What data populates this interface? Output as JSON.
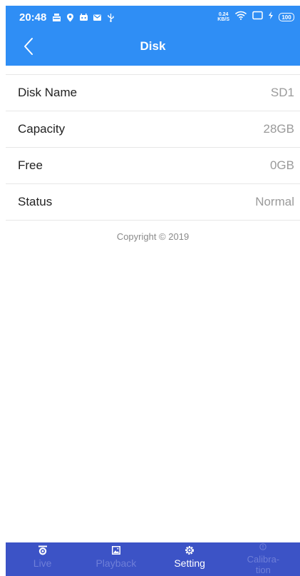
{
  "status_bar": {
    "time": "20:48",
    "net_speed_value": "0.24",
    "net_speed_unit": "KB/S",
    "battery": "100",
    "icons": [
      "notification-icon",
      "location-icon",
      "android-icon",
      "mail-icon",
      "usb-icon",
      "wifi-icon",
      "screen-icon",
      "charging-icon"
    ]
  },
  "header": {
    "title": "Disk",
    "back_icon": "chevron-left-icon"
  },
  "disk_info": [
    {
      "label": "Disk Name",
      "value": "SD1"
    },
    {
      "label": "Capacity",
      "value": "28GB"
    },
    {
      "label": "Free",
      "value": "0GB"
    },
    {
      "label": "Status",
      "value": "Normal"
    }
  ],
  "footer": {
    "copyright": "Copyright © 2019"
  },
  "tab_bar": {
    "active": "Setting",
    "tabs": [
      {
        "label": "Live",
        "icon": "camera-icon"
      },
      {
        "label": "Playback",
        "icon": "image-icon"
      },
      {
        "label": "Setting",
        "icon": "gear-icon"
      },
      {
        "label": "Calibra-tion",
        "icon": "info-icon"
      }
    ]
  },
  "colors": {
    "header_bg": "#2f8ef5",
    "tab_bar_bg": "#3c53c6",
    "tab_inactive": "#6f7fd8",
    "value_text": "#9a9a9a"
  }
}
